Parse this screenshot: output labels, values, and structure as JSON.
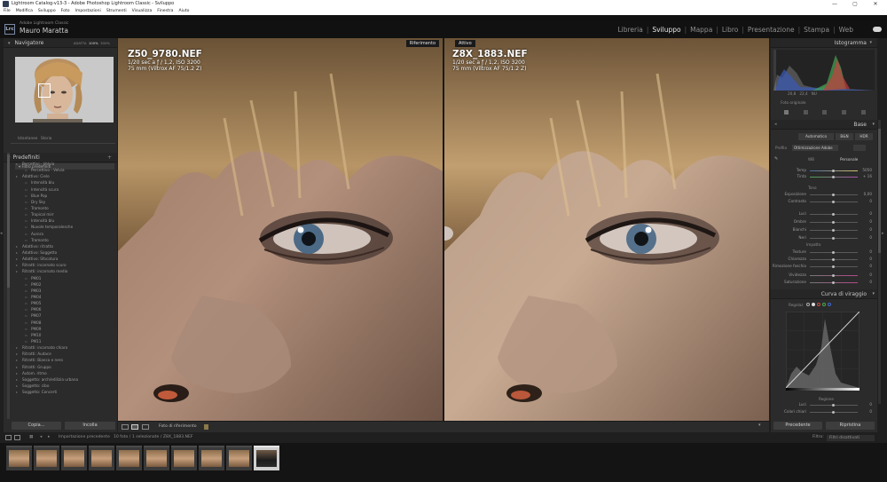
{
  "window": {
    "title": "Lightroom Catalog-v13-3 - Adobe Photoshop Lightroom Classic - Sviluppo",
    "controls": [
      "—",
      "▢",
      "✕"
    ]
  },
  "menubar": [
    "File",
    "Modifica",
    "Sviluppo",
    "Foto",
    "Impostazioni",
    "Strumenti",
    "Visualizza",
    "Finestra",
    "Aiuto"
  ],
  "identity": {
    "logo": "Lrc",
    "product": "Adobe Lightroom Classic",
    "user": "Mauro Maratta"
  },
  "modules": {
    "items": [
      "Libreria",
      "Sviluppo",
      "Mappa",
      "Libro",
      "Presentazione",
      "Stampa",
      "Web"
    ],
    "active": "Sviluppo"
  },
  "navigator": {
    "title": "Navigatore",
    "zoom": [
      "ADATTA",
      "100%",
      "300%"
    ]
  },
  "snapshots": {
    "label1": "Istantanee",
    "label2": "Storia"
  },
  "presets": {
    "title": "Predefiniti",
    "filter": "Filtro predefiniti",
    "items": [
      {
        "label": "Percettivi - Velvia",
        "kind": "group"
      },
      {
        "label": "Percettivo - Velvia",
        "kind": "item"
      },
      {
        "label": "Adattivo: Cielo",
        "kind": "group"
      },
      {
        "label": "Intensità blu",
        "kind": "item"
      },
      {
        "label": "Intensità scura",
        "kind": "item"
      },
      {
        "label": "Blue Pop",
        "kind": "item"
      },
      {
        "label": "Dry Sky",
        "kind": "item"
      },
      {
        "label": "Tramonto",
        "kind": "item"
      },
      {
        "label": "Tropical mirr",
        "kind": "item"
      },
      {
        "label": "Intensità blu",
        "kind": "item"
      },
      {
        "label": "Nuvole temporalesche",
        "kind": "item"
      },
      {
        "label": "Aurora",
        "kind": "item"
      },
      {
        "label": "Tramonto",
        "kind": "item"
      },
      {
        "label": "Adattivo: ritratto",
        "kind": "group"
      },
      {
        "label": "Adattivo: Soggetto",
        "kind": "group"
      },
      {
        "label": "Adattivo: Sfocatura",
        "kind": "group"
      },
      {
        "label": "Ritratti: incarnato scuro",
        "kind": "group"
      },
      {
        "label": "Ritratti: incarnato medio",
        "kind": "group"
      },
      {
        "label": "PM01",
        "kind": "item"
      },
      {
        "label": "PM02",
        "kind": "item"
      },
      {
        "label": "PM03",
        "kind": "item"
      },
      {
        "label": "PM04",
        "kind": "item"
      },
      {
        "label": "PM05",
        "kind": "item"
      },
      {
        "label": "PM06",
        "kind": "item"
      },
      {
        "label": "PM07",
        "kind": "item"
      },
      {
        "label": "PM08",
        "kind": "item"
      },
      {
        "label": "PM09",
        "kind": "item"
      },
      {
        "label": "PM10",
        "kind": "item"
      },
      {
        "label": "PM11",
        "kind": "item"
      },
      {
        "label": "Ritratti: incarnato chiaro",
        "kind": "group"
      },
      {
        "label": "Ritratti: Audace",
        "kind": "group"
      },
      {
        "label": "Ritratti: Bianco e nero",
        "kind": "group"
      },
      {
        "label": "Ritratti: Gruppo",
        "kind": "group"
      },
      {
        "label": "Autom. ritmo",
        "kind": "group"
      },
      {
        "label": "Soggetto: arch/edilizia urbana",
        "kind": "group"
      },
      {
        "label": "Soggetto: cibo",
        "kind": "group"
      },
      {
        "label": "Soggetto: Concerti",
        "kind": "group"
      }
    ]
  },
  "left_buttons": {
    "copy": "Copia...",
    "paste": "Incolla"
  },
  "views": {
    "left": {
      "tag": "Riferimento",
      "filename": "Z50_9780.NEF",
      "exposure": "1/20 sec a ƒ / 1,2, ISO 3200",
      "lens": "75 mm (Viltrox AF 75/1.2 Z)"
    },
    "right": {
      "tag": "Attivo",
      "filename": "Z8X_1883.NEF",
      "exposure": "1/20 sec a ƒ / 1,2, ISO 3200",
      "lens": "75 mm (Viltrox AF 75/1.2 Z)"
    }
  },
  "toolbar": {
    "ref_label": "Foto di riferimento"
  },
  "histogram": {
    "title": "Istogramma",
    "readout": [
      "20,8",
      "22,4",
      "NU"
    ],
    "original": "Foto originale"
  },
  "basic": {
    "title": "Base",
    "profile_buttons": [
      "Automatico",
      "B&N",
      "HDR"
    ],
    "profile_label": "Profilo",
    "profile_value": "Ottimizzazione Adobe",
    "wb_label": "WB",
    "wb_value": "Personale",
    "temp_label": "Temp",
    "temp_value": "5050",
    "tint_label": "Tinta",
    "tint_value": "+ 16",
    "tone_label": "Tono",
    "tone_sliders": [
      {
        "label": "Esposizione",
        "value": "0,00"
      },
      {
        "label": "Contrasto",
        "value": "0"
      },
      {
        "label": "Luci",
        "value": "0"
      },
      {
        "label": "Ombre",
        "value": "0"
      },
      {
        "label": "Bianchi",
        "value": "0"
      },
      {
        "label": "Neri",
        "value": "0"
      }
    ],
    "presence_label": "Impatto",
    "presence_sliders": [
      {
        "label": "Texture",
        "value": "0"
      },
      {
        "label": "Chiarezza",
        "value": "0"
      },
      {
        "label": "Rimozione foschia",
        "value": "0"
      },
      {
        "label": "Vividezza",
        "value": "0"
      },
      {
        "label": "Saturazione",
        "value": "0"
      }
    ]
  },
  "curve": {
    "title": "Curva di viraggio",
    "channel_label": "Regolaz",
    "region_label": "Regione",
    "region_sliders": [
      {
        "label": "Luci",
        "value": "0"
      },
      {
        "label": "Colori chiari",
        "value": "0"
      }
    ]
  },
  "right_buttons": {
    "previous": "Precedente",
    "reset": "Ripristina"
  },
  "filmstrip": {
    "source": "Importazione precedente",
    "info": "10 foto / 1 selezionate / Z8X_1883.NEF",
    "filter_label": "Filtro:",
    "filter_value": "Filtri disattivati",
    "count": 10,
    "selected_index": 9
  },
  "colors": {
    "accent": "#e8e8e8",
    "panel": "#2b2b2b",
    "bg": "#1f1f1f",
    "film": "#141414"
  }
}
